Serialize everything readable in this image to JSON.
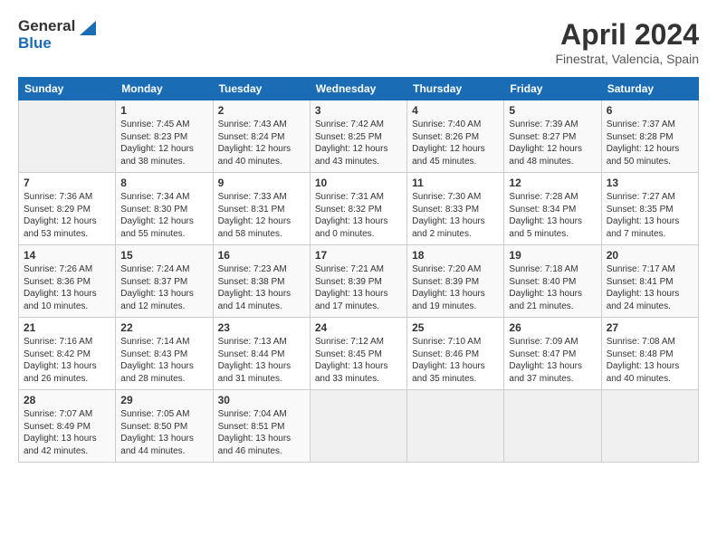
{
  "header": {
    "logo_line1": "General",
    "logo_line2": "Blue",
    "title": "April 2024",
    "subtitle": "Finestrat, Valencia, Spain"
  },
  "calendar": {
    "days_of_week": [
      "Sunday",
      "Monday",
      "Tuesday",
      "Wednesday",
      "Thursday",
      "Friday",
      "Saturday"
    ],
    "weeks": [
      [
        {
          "day": "",
          "empty": true
        },
        {
          "day": "1",
          "sunrise": "Sunrise: 7:45 AM",
          "sunset": "Sunset: 8:23 PM",
          "daylight": "Daylight: 12 hours and 38 minutes."
        },
        {
          "day": "2",
          "sunrise": "Sunrise: 7:43 AM",
          "sunset": "Sunset: 8:24 PM",
          "daylight": "Daylight: 12 hours and 40 minutes."
        },
        {
          "day": "3",
          "sunrise": "Sunrise: 7:42 AM",
          "sunset": "Sunset: 8:25 PM",
          "daylight": "Daylight: 12 hours and 43 minutes."
        },
        {
          "day": "4",
          "sunrise": "Sunrise: 7:40 AM",
          "sunset": "Sunset: 8:26 PM",
          "daylight": "Daylight: 12 hours and 45 minutes."
        },
        {
          "day": "5",
          "sunrise": "Sunrise: 7:39 AM",
          "sunset": "Sunset: 8:27 PM",
          "daylight": "Daylight: 12 hours and 48 minutes."
        },
        {
          "day": "6",
          "sunrise": "Sunrise: 7:37 AM",
          "sunset": "Sunset: 8:28 PM",
          "daylight": "Daylight: 12 hours and 50 minutes."
        }
      ],
      [
        {
          "day": "7",
          "sunrise": "Sunrise: 7:36 AM",
          "sunset": "Sunset: 8:29 PM",
          "daylight": "Daylight: 12 hours and 53 minutes."
        },
        {
          "day": "8",
          "sunrise": "Sunrise: 7:34 AM",
          "sunset": "Sunset: 8:30 PM",
          "daylight": "Daylight: 12 hours and 55 minutes."
        },
        {
          "day": "9",
          "sunrise": "Sunrise: 7:33 AM",
          "sunset": "Sunset: 8:31 PM",
          "daylight": "Daylight: 12 hours and 58 minutes."
        },
        {
          "day": "10",
          "sunrise": "Sunrise: 7:31 AM",
          "sunset": "Sunset: 8:32 PM",
          "daylight": "Daylight: 13 hours and 0 minutes."
        },
        {
          "day": "11",
          "sunrise": "Sunrise: 7:30 AM",
          "sunset": "Sunset: 8:33 PM",
          "daylight": "Daylight: 13 hours and 2 minutes."
        },
        {
          "day": "12",
          "sunrise": "Sunrise: 7:28 AM",
          "sunset": "Sunset: 8:34 PM",
          "daylight": "Daylight: 13 hours and 5 minutes."
        },
        {
          "day": "13",
          "sunrise": "Sunrise: 7:27 AM",
          "sunset": "Sunset: 8:35 PM",
          "daylight": "Daylight: 13 hours and 7 minutes."
        }
      ],
      [
        {
          "day": "14",
          "sunrise": "Sunrise: 7:26 AM",
          "sunset": "Sunset: 8:36 PM",
          "daylight": "Daylight: 13 hours and 10 minutes."
        },
        {
          "day": "15",
          "sunrise": "Sunrise: 7:24 AM",
          "sunset": "Sunset: 8:37 PM",
          "daylight": "Daylight: 13 hours and 12 minutes."
        },
        {
          "day": "16",
          "sunrise": "Sunrise: 7:23 AM",
          "sunset": "Sunset: 8:38 PM",
          "daylight": "Daylight: 13 hours and 14 minutes."
        },
        {
          "day": "17",
          "sunrise": "Sunrise: 7:21 AM",
          "sunset": "Sunset: 8:39 PM",
          "daylight": "Daylight: 13 hours and 17 minutes."
        },
        {
          "day": "18",
          "sunrise": "Sunrise: 7:20 AM",
          "sunset": "Sunset: 8:39 PM",
          "daylight": "Daylight: 13 hours and 19 minutes."
        },
        {
          "day": "19",
          "sunrise": "Sunrise: 7:18 AM",
          "sunset": "Sunset: 8:40 PM",
          "daylight": "Daylight: 13 hours and 21 minutes."
        },
        {
          "day": "20",
          "sunrise": "Sunrise: 7:17 AM",
          "sunset": "Sunset: 8:41 PM",
          "daylight": "Daylight: 13 hours and 24 minutes."
        }
      ],
      [
        {
          "day": "21",
          "sunrise": "Sunrise: 7:16 AM",
          "sunset": "Sunset: 8:42 PM",
          "daylight": "Daylight: 13 hours and 26 minutes."
        },
        {
          "day": "22",
          "sunrise": "Sunrise: 7:14 AM",
          "sunset": "Sunset: 8:43 PM",
          "daylight": "Daylight: 13 hours and 28 minutes."
        },
        {
          "day": "23",
          "sunrise": "Sunrise: 7:13 AM",
          "sunset": "Sunset: 8:44 PM",
          "daylight": "Daylight: 13 hours and 31 minutes."
        },
        {
          "day": "24",
          "sunrise": "Sunrise: 7:12 AM",
          "sunset": "Sunset: 8:45 PM",
          "daylight": "Daylight: 13 hours and 33 minutes."
        },
        {
          "day": "25",
          "sunrise": "Sunrise: 7:10 AM",
          "sunset": "Sunset: 8:46 PM",
          "daylight": "Daylight: 13 hours and 35 minutes."
        },
        {
          "day": "26",
          "sunrise": "Sunrise: 7:09 AM",
          "sunset": "Sunset: 8:47 PM",
          "daylight": "Daylight: 13 hours and 37 minutes."
        },
        {
          "day": "27",
          "sunrise": "Sunrise: 7:08 AM",
          "sunset": "Sunset: 8:48 PM",
          "daylight": "Daylight: 13 hours and 40 minutes."
        }
      ],
      [
        {
          "day": "28",
          "sunrise": "Sunrise: 7:07 AM",
          "sunset": "Sunset: 8:49 PM",
          "daylight": "Daylight: 13 hours and 42 minutes."
        },
        {
          "day": "29",
          "sunrise": "Sunrise: 7:05 AM",
          "sunset": "Sunset: 8:50 PM",
          "daylight": "Daylight: 13 hours and 44 minutes."
        },
        {
          "day": "30",
          "sunrise": "Sunrise: 7:04 AM",
          "sunset": "Sunset: 8:51 PM",
          "daylight": "Daylight: 13 hours and 46 minutes."
        },
        {
          "day": "",
          "empty": true
        },
        {
          "day": "",
          "empty": true
        },
        {
          "day": "",
          "empty": true
        },
        {
          "day": "",
          "empty": true
        }
      ]
    ]
  }
}
